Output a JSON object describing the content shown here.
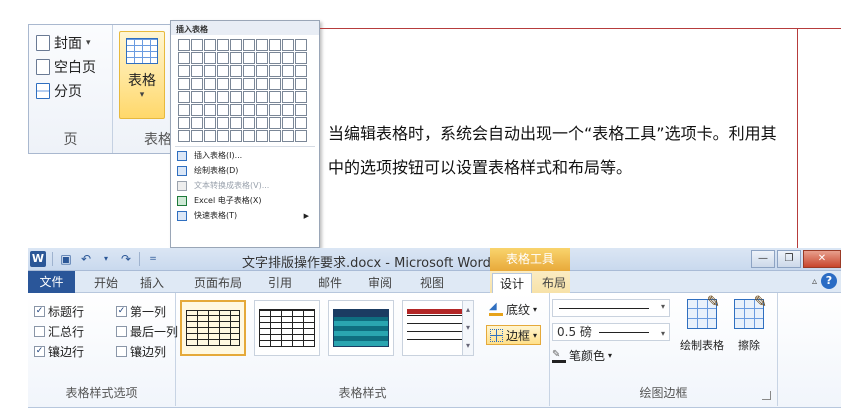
{
  "top_ribbon": {
    "page_items": [
      "封面",
      "空白页",
      "分页"
    ],
    "page_group_label": "页",
    "table_button_label": "表格",
    "table_group_label": "表格"
  },
  "insert_menu": {
    "title": "插入表格",
    "items": [
      {
        "label": "插入表格(I)...",
        "icon": "insert-table-icon",
        "disabled": false
      },
      {
        "label": "绘制表格(D)",
        "icon": "draw-table-icon",
        "disabled": false
      },
      {
        "label": "文本转换成表格(V)...",
        "icon": "convert-text-icon",
        "disabled": true
      },
      {
        "label": "Excel 电子表格(X)",
        "icon": "excel-icon",
        "disabled": false
      },
      {
        "label": "快速表格(T)",
        "icon": "quick-table-icon",
        "disabled": false
      }
    ]
  },
  "description": "当编辑表格时，系统会自动出现一个“表格工具”选项卡。利用其中的选项按钮可以设置表格样式和布局等。",
  "window": {
    "title": "文字排版操作要求.docx - Microsoft Word",
    "context_tab": "表格工具",
    "tabs": [
      "文件",
      "开始",
      "插入",
      "页面布局",
      "引用",
      "邮件",
      "审阅",
      "视图",
      "设计",
      "布局"
    ],
    "active_tab": "设计",
    "help": "?"
  },
  "style_options": {
    "items": [
      {
        "label": "标题行",
        "checked": true
      },
      {
        "label": "第一列",
        "checked": true
      },
      {
        "label": "汇总行",
        "checked": false
      },
      {
        "label": "最后一列",
        "checked": false
      },
      {
        "label": "镶边行",
        "checked": true
      },
      {
        "label": "镶边列",
        "checked": false
      }
    ],
    "group_label": "表格样式选项"
  },
  "table_styles": {
    "group_label": "表格样式",
    "shading_label": "底纹",
    "borders_label": "边框"
  },
  "draw_borders": {
    "pen_weight": "0.5 磅",
    "pen_color_label": "笔颜色",
    "draw_table_label": "绘制表格",
    "eraser_label": "擦除",
    "group_label": "绘图边框"
  }
}
